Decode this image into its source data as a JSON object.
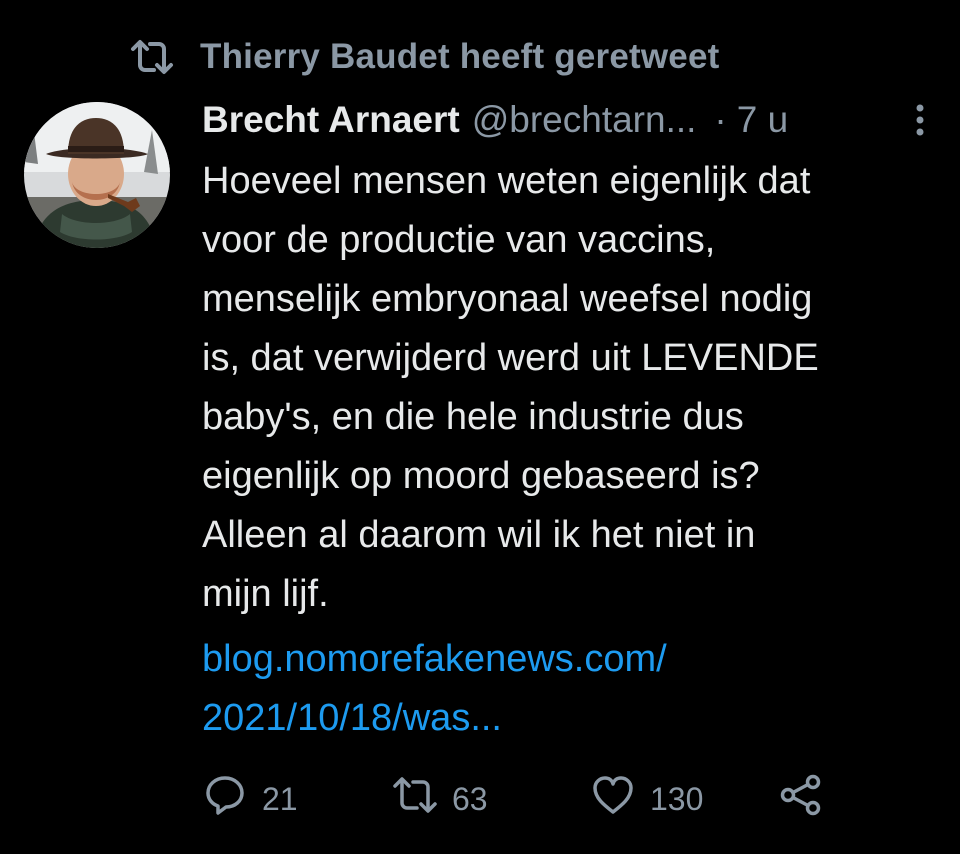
{
  "retweet_banner": {
    "icon": "retweet-icon",
    "text": "Thierry Baudet heeft geretweet"
  },
  "tweet": {
    "author_name": "Brecht Arnaert",
    "handle": "@brechtarn...",
    "separator": "·",
    "time": "7 u",
    "more_icon": "more-vertical-icon",
    "avatar": "avatar-photo",
    "text": "Hoeveel mensen weten eigenlijk dat\nvoor de productie van vaccins,\nmenselijk embryonaal weefsel nodig\nis, dat verwijderd werd uit LEVENDE\nbaby's, en die hele industrie dus\neigenlijk op moord gebaseerd is?\nAlleen al daarom wil ik het niet in\nmijn lijf.",
    "link": "blog.nomorefakenews.com/\n2021/10/18/was..."
  },
  "actions": {
    "reply": {
      "icon": "reply-icon",
      "count": "21"
    },
    "retweet": {
      "icon": "retweet-icon",
      "count": "63"
    },
    "like": {
      "icon": "heart-icon",
      "count": "130"
    },
    "share": {
      "icon": "share-icon"
    }
  },
  "colors": {
    "background": "#000000",
    "text": "#e7e9ea",
    "secondary": "#8b98a5",
    "link": "#1d9bf0"
  }
}
